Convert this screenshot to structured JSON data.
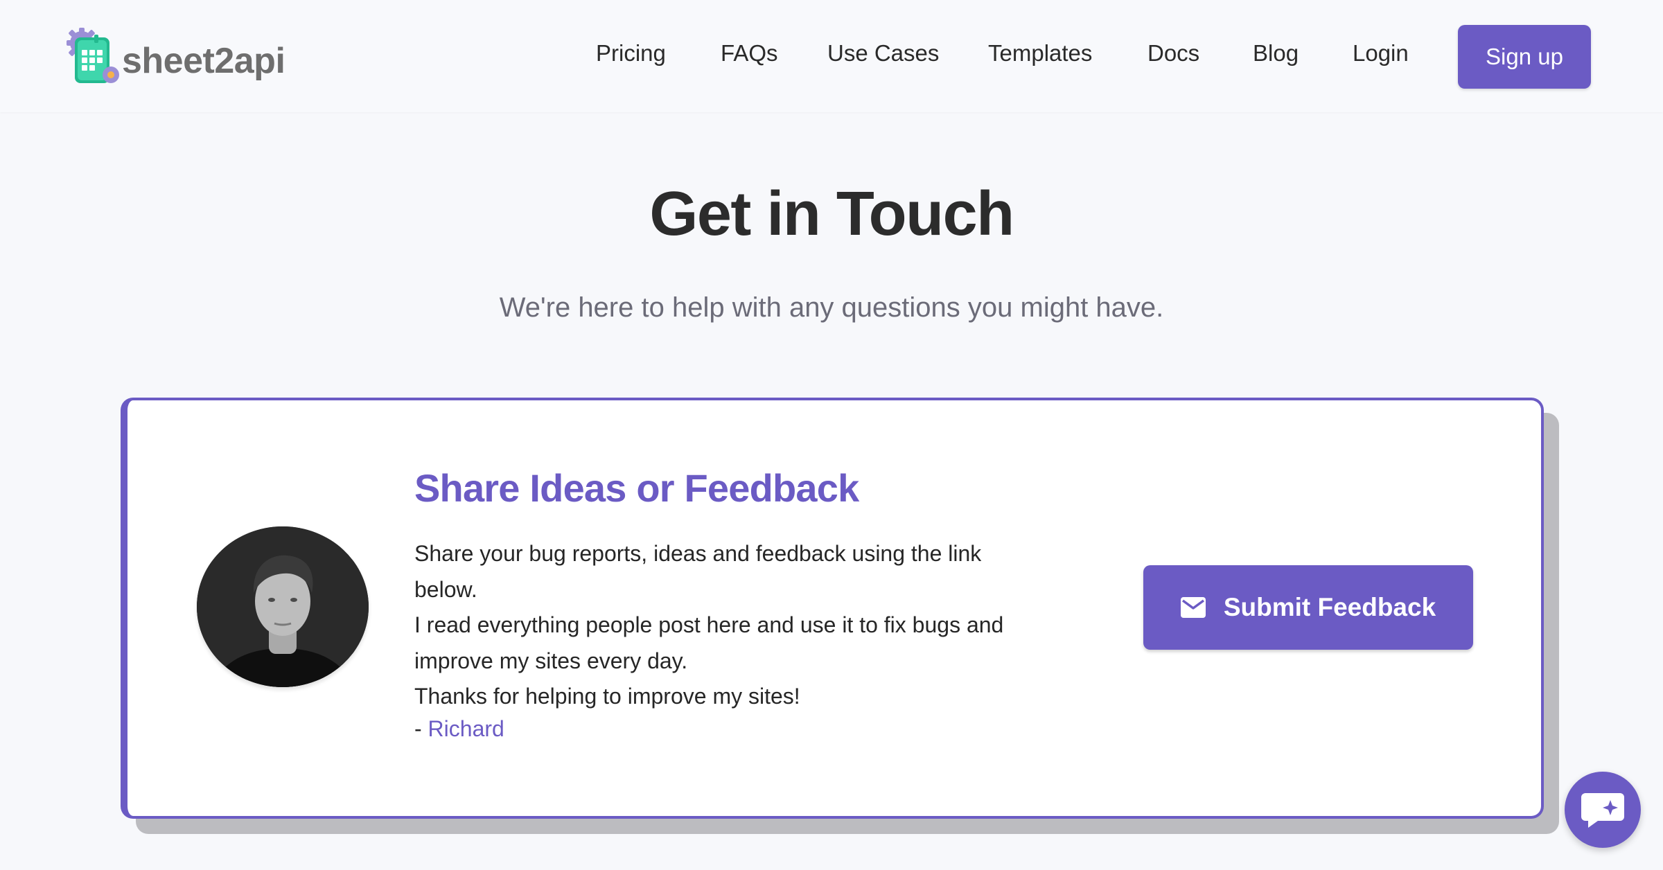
{
  "header": {
    "logo_text": "sheet2api",
    "nav": [
      {
        "label": "Pricing"
      },
      {
        "label": "FAQs"
      },
      {
        "label": "Use Cases"
      },
      {
        "label": "Templates"
      },
      {
        "label": "Docs"
      },
      {
        "label": "Blog"
      },
      {
        "label": "Login"
      }
    ],
    "signup_label": "Sign up"
  },
  "hero": {
    "title": "Get in Touch",
    "subtitle": "We're here to help with any questions you might have."
  },
  "feedback_card": {
    "title": "Share Ideas or Feedback",
    "body_lines": [
      "Share your bug reports, ideas and feedback using the link below.",
      "I read everything people post here and use it to fix bugs and improve my sites every day.",
      "Thanks for helping to improve my sites!"
    ],
    "sign_prefix": "- ",
    "sign_name": "Richard",
    "button_label": "Submit Feedback",
    "button_icon": "mail-icon"
  },
  "chat_widget": {
    "icon": "chat-bubble-icon"
  },
  "colors": {
    "accent": "#6b5bc4",
    "background": "#f7f8fb",
    "card": "#ffffff",
    "card_shadow": "#bcbcc0",
    "logo_green": "#2ec4a0"
  }
}
